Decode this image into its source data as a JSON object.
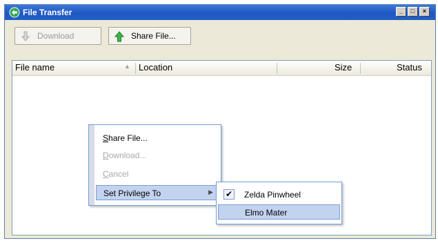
{
  "window": {
    "title": "File Transfer"
  },
  "title_buttons": {
    "minimize": "_",
    "maximize": "□",
    "close": "×"
  },
  "toolbar": {
    "download_label": "Download",
    "share_label": "Share File..."
  },
  "columns": [
    {
      "label": "File name"
    },
    {
      "label": "Location"
    },
    {
      "label": "Size"
    },
    {
      "label": "Status"
    }
  ],
  "context_menu": {
    "items": [
      {
        "label_first": "S",
        "label_rest": "hare File...",
        "enabled": true
      },
      {
        "label_first": "D",
        "label_rest": "ownload...",
        "enabled": false
      },
      {
        "label_first": "C",
        "label_rest": "ancel",
        "enabled": false
      },
      {
        "label": "Set Privilege To",
        "enabled": true,
        "active": true,
        "has_submenu": true
      }
    ]
  },
  "submenu": {
    "items": [
      {
        "label": "Zelda Pinwheel",
        "checked": true,
        "check_glyph": "✔"
      },
      {
        "label": "Elmo Mater",
        "checked": false,
        "active": true
      }
    ]
  },
  "colors": {
    "titlebar": "#2260c8",
    "selection": "#c2d3f0",
    "menu_border": "#6e9fd8"
  }
}
